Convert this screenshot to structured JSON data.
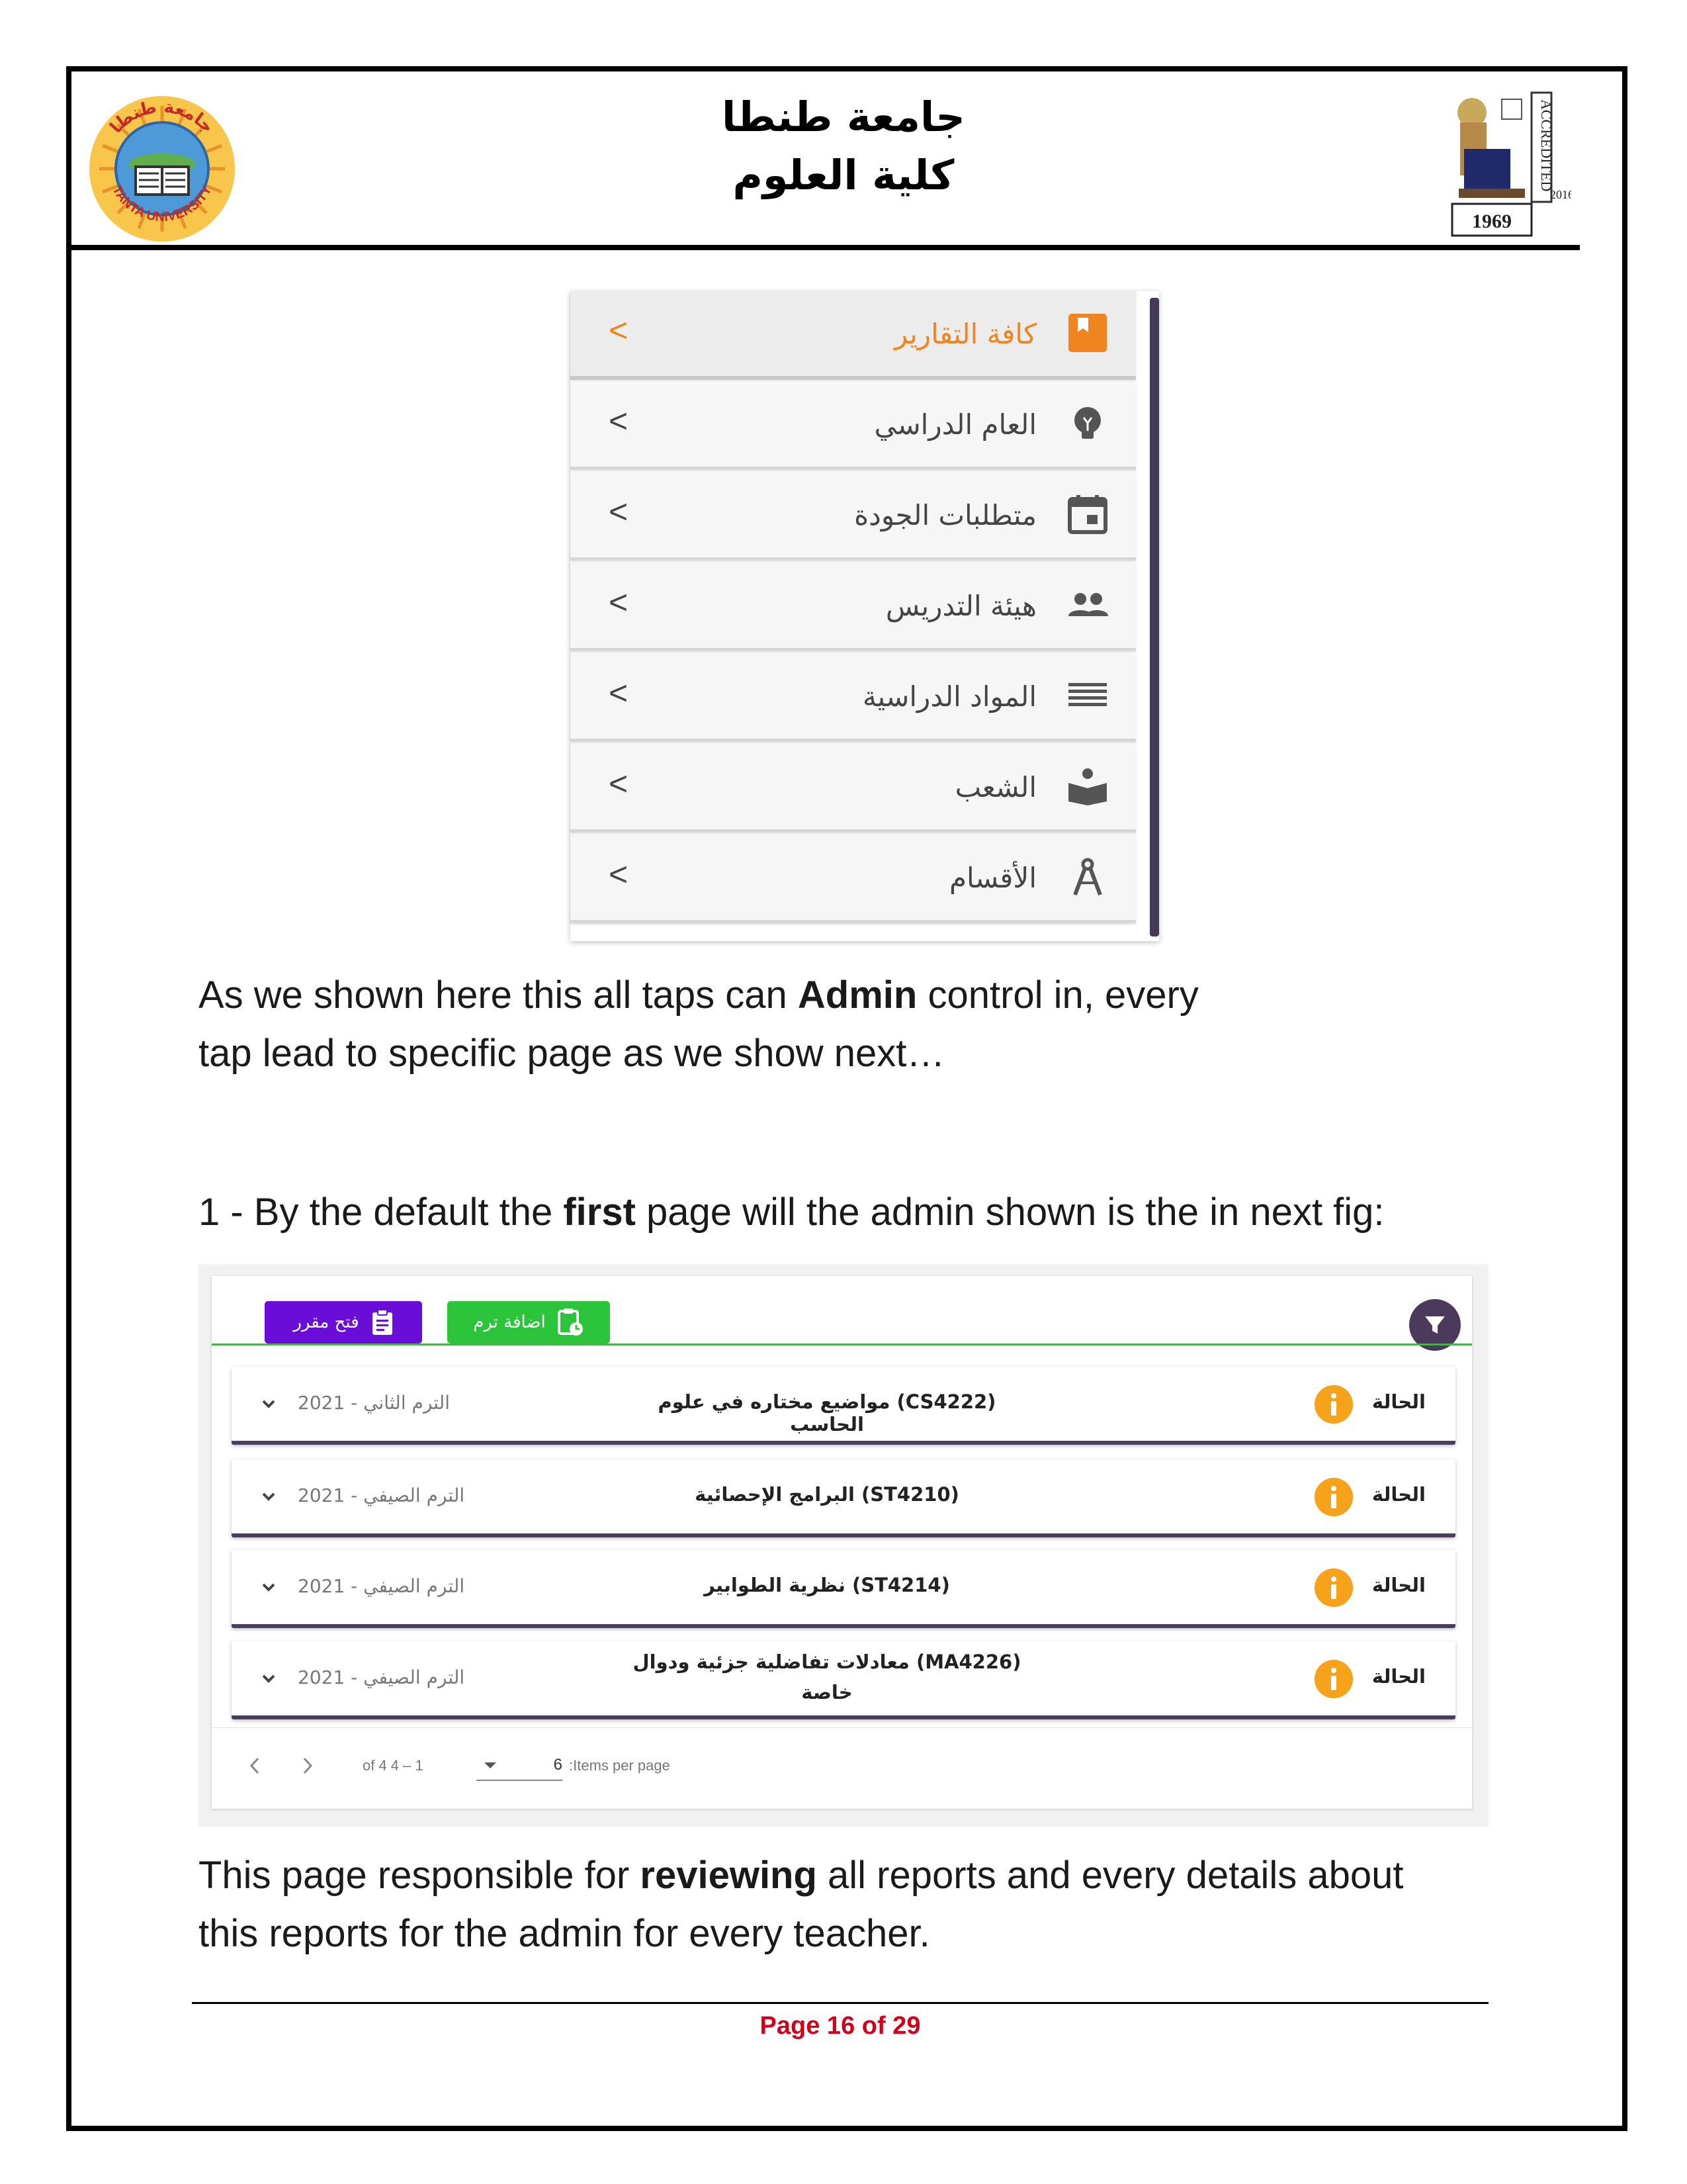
{
  "header": {
    "title_line1": "جامعة طنطا",
    "title_line2": "كلية العلوم",
    "left_logo": {
      "type": "tanta-university-seal-icon",
      "text": "جامعة طنطا TANTA UNIVERSITY"
    },
    "right_logo": {
      "type": "accredited-pharaoh-logo-icon",
      "text": "ACCREDITED 2016",
      "year": "1969"
    }
  },
  "menu": {
    "items": [
      {
        "label": "كافة التقارير",
        "icon": "report-bookmark-icon",
        "active": true
      },
      {
        "label": "العام الدراسي",
        "icon": "lightbulb-icon",
        "active": false
      },
      {
        "label": "متطلبات الجودة",
        "icon": "calendar-icon",
        "active": false
      },
      {
        "label": "هيئة التدريس",
        "icon": "people-icon",
        "active": false
      },
      {
        "label": "المواد الدراسية",
        "icon": "list-lines-icon",
        "active": false
      },
      {
        "label": "الشعب",
        "icon": "reader-icon",
        "active": false
      },
      {
        "label": "الأقسام",
        "icon": "compass-icon",
        "active": false
      }
    ],
    "chevron": "<"
  },
  "text": {
    "p1_a": "As we shown here this all taps can ",
    "p1_b": "Admin",
    "p1_c": " control in, every",
    "p1_line2": "tap lead to specific page as we show next…",
    "p2_a": "1 - By the default the ",
    "p2_b": "first",
    "p2_c": " page will the admin shown is the in next fig:",
    "p3_a": "This page responsible for ",
    "p3_b": "reviewing",
    "p3_c": " all reports and every details about",
    "p3_line2": "this reports for the admin for every teacher."
  },
  "table": {
    "buttons": {
      "open_course": "فتح مقرر",
      "add_term": "اضافة ترم"
    },
    "rows": [
      {
        "status": "الحالة",
        "title": "(CS4222) مواضيع مختاره في علوم الحاسب",
        "title_line2": "",
        "term": "2021 - الترم الثاني"
      },
      {
        "status": "الحالة",
        "title": "(ST4210) البرامج الإحصائية",
        "title_line2": "",
        "term": "2021 - الترم الصيفي"
      },
      {
        "status": "الحالة",
        "title": "(ST4214) نظرية الطوابير",
        "title_line2": "",
        "term": "2021 - الترم الصيفي"
      },
      {
        "status": "الحالة",
        "title": "(MA4226) معادلات تفاضلية جزئية ودوال",
        "title_line2": "خاصة",
        "term": "2021 - الترم الصيفي"
      }
    ],
    "pager": {
      "range": "of 4 4 – 1",
      "per_page_value": "6",
      "per_page_label": ":Items per page"
    }
  },
  "footer": {
    "page": "Page 16 of 29"
  },
  "colors": {
    "active": "#f0841e",
    "menu_bar": "#453a55",
    "open_btn": "#6a0dd8",
    "add_btn": "#2bc43a",
    "info": "#f6a21b",
    "footer": "#d0021b"
  }
}
